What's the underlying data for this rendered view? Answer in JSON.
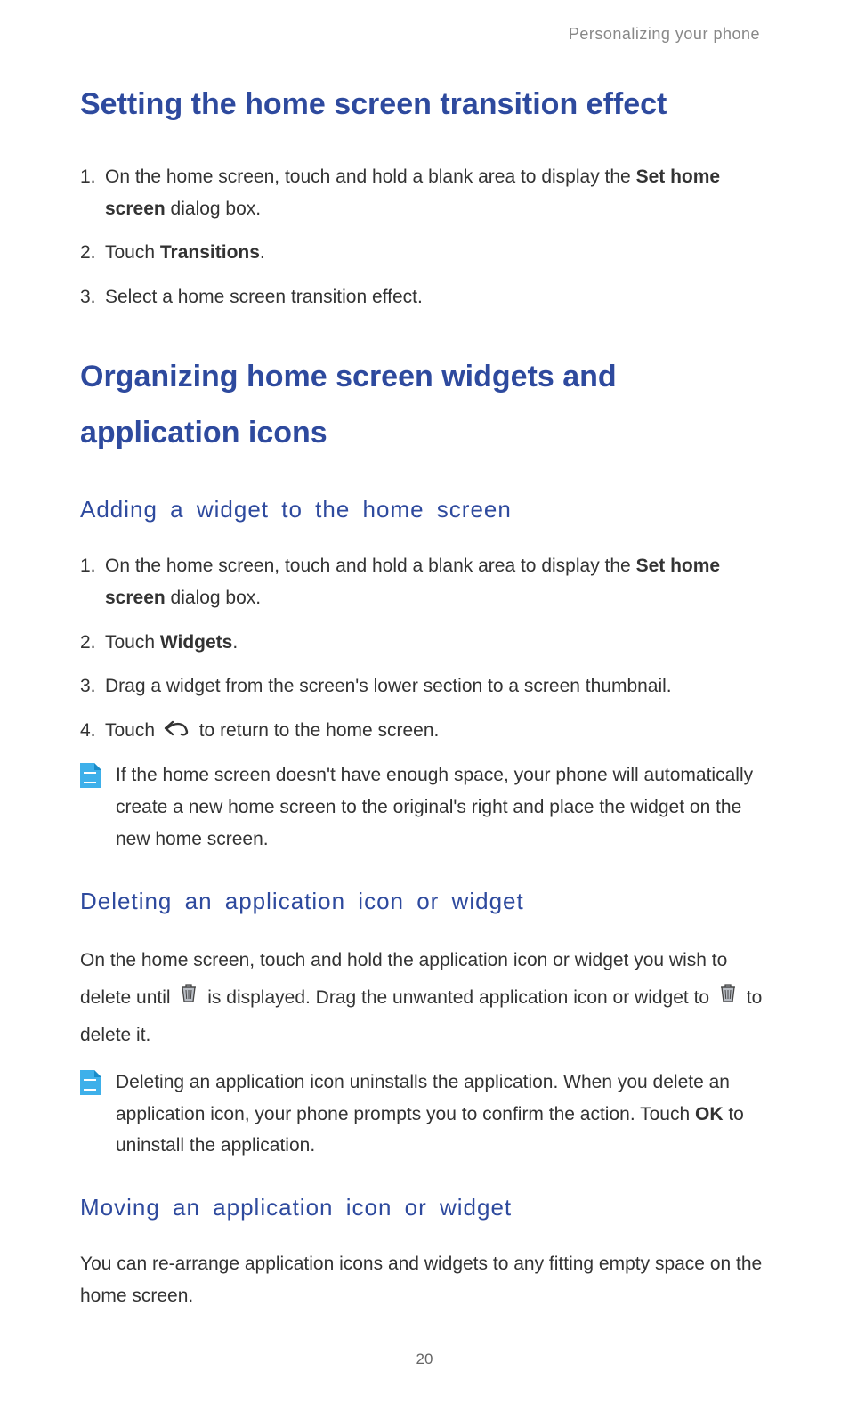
{
  "header": {
    "chapter": "Personalizing your phone"
  },
  "section1": {
    "title": "Setting the home screen transition effect",
    "steps": [
      {
        "num": "1.",
        "pre": "On the home screen, touch and hold a blank area to display the ",
        "bold": "Set home screen",
        "post": " dialog box."
      },
      {
        "num": "2.",
        "pre": "Touch ",
        "bold": "Transitions",
        "post": "."
      },
      {
        "num": "3.",
        "pre": "Select a home screen transition effect.",
        "bold": "",
        "post": ""
      }
    ]
  },
  "section2": {
    "title": "Organizing home screen widgets and application icons",
    "sub1": {
      "title": "Adding a widget to the home screen",
      "steps": [
        {
          "num": "1.",
          "pre": "On the home screen, touch and hold a blank area to display the ",
          "bold": "Set home screen",
          "post": " dialog box."
        },
        {
          "num": "2.",
          "pre": "Touch ",
          "bold": "Widgets",
          "post": "."
        },
        {
          "num": "3.",
          "pre": "Drag a widget from the screen's lower section to a screen thumbnail.",
          "bold": "",
          "post": ""
        },
        {
          "num": "4.",
          "pre": "Touch ",
          "icon": "back",
          "post": " to return to the home screen."
        }
      ],
      "note": "If the home screen doesn't have enough space, your phone will automatically create a new home screen to the original's right and place the widget on the new home screen."
    },
    "sub2": {
      "title": "Deleting an application icon or widget",
      "para_parts": {
        "p1": "On the home screen, touch and hold the application icon or widget you wish to delete until ",
        "p2": " is displayed. Drag the unwanted application icon or widget to ",
        "p3": " to delete it."
      },
      "note_pre": "Deleting an application icon uninstalls the application. When you delete an application icon, your phone prompts you to confirm the action. Touch ",
      "note_bold": "OK",
      "note_post": " to uninstall the application."
    },
    "sub3": {
      "title": "Moving an application icon or widget",
      "para": "You can re-arrange application icons and widgets to any fitting empty space on the home screen."
    }
  },
  "page_number": "20"
}
